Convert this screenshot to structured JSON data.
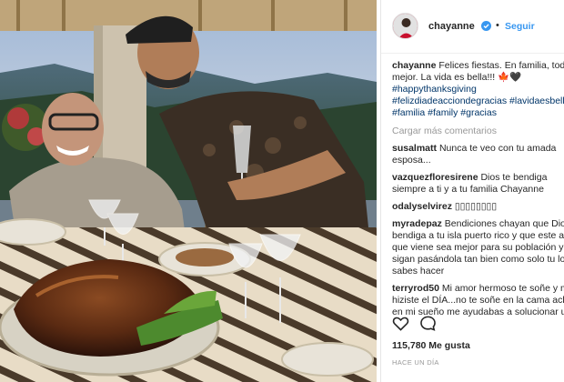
{
  "post": {
    "username": "chayanne",
    "separator": "•",
    "follow_label": "Seguir",
    "caption": {
      "username": "chayanne",
      "line1": "Felices fiestas. En familia, todo es",
      "line2": "mejor. La vida es bella!!! ",
      "emoji": "🍁🖤",
      "hashtags": [
        "#happythanksgiving",
        "#felizdiadeacciondegracias",
        "#lavidaesbella",
        "#familia",
        "#family",
        "#gracias"
      ]
    },
    "load_more_label": "Cargar más comentarios",
    "comments": [
      {
        "user": "susalmatt",
        "lines": [
          "Nunca te veo con tu amada",
          "esposa..."
        ]
      },
      {
        "user": "vazquezfloresirene",
        "lines": [
          "Dios te bendiga",
          "siempre a ti y a tu familia Chayanne"
        ]
      },
      {
        "user": "odalyselvirez",
        "lines": [
          "▯▯▯▯▯▯▯▯"
        ]
      },
      {
        "user": "myradepaz",
        "lines": [
          "Bendiciones chayan que Dios",
          "bendiga a tu isla puerto rico y que este año",
          "que viene sea mejor para su población y",
          "sigan pasándola tan bien como solo tu lo",
          "sabes hacer"
        ]
      },
      {
        "user": "terryrod50",
        "lines": [
          "Mi amor hermoso te soñe y me",
          "hiziste el DÍA...no te soñe en la cama aclara",
          "en mi sueño me ayudabas a solucionar un"
        ]
      }
    ],
    "likes_text": "115,780 Me gusta",
    "time_text": "HACE UN DÍA"
  },
  "icons": {
    "like": "heart-icon",
    "comment": "comment-icon",
    "verified": "verified-badge-icon"
  },
  "colors": {
    "link": "#3897f0",
    "hashtag": "#003569",
    "muted": "#999999"
  }
}
